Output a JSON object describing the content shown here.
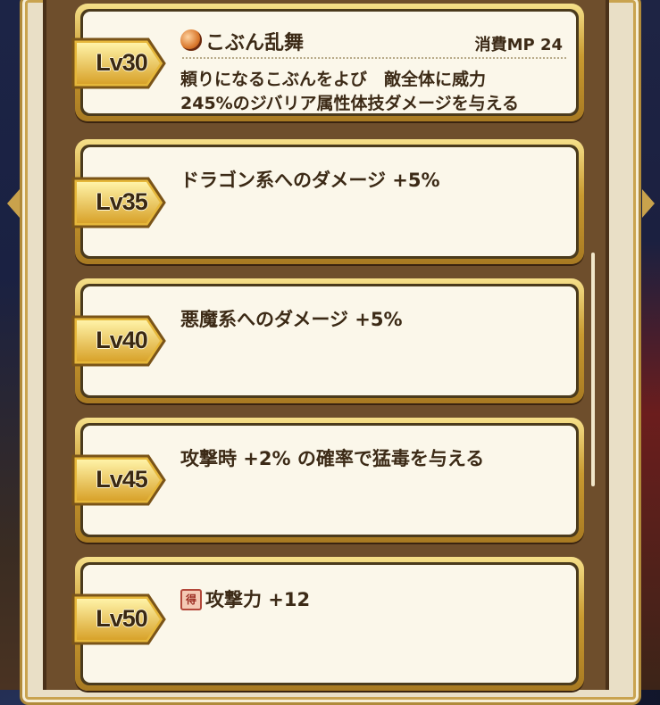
{
  "skills": [
    {
      "level": "Lv30",
      "icon": "orb-skill-icon",
      "name": "こぶん乱舞",
      "mp": "消費MP 24",
      "desc1": "頼りになるこぶんをよび　敵全体に威力",
      "desc2": "245%のジバリア属性体技ダメージを与える"
    },
    {
      "level": "Lv35",
      "title": "ドラゴン系へのダメージ +5%"
    },
    {
      "level": "Lv40",
      "title": "悪魔系へのダメージ +5%"
    },
    {
      "level": "Lv45",
      "title": "攻撃時 +2% の確率で猛毒を与える"
    },
    {
      "level": "Lv50",
      "badge": "得",
      "title": "攻撃力 +12"
    }
  ],
  "colors": {
    "gold": "#c99a30",
    "card": "#fbf7ea",
    "text": "#3c2a16",
    "panel": "#6e4e2c"
  }
}
